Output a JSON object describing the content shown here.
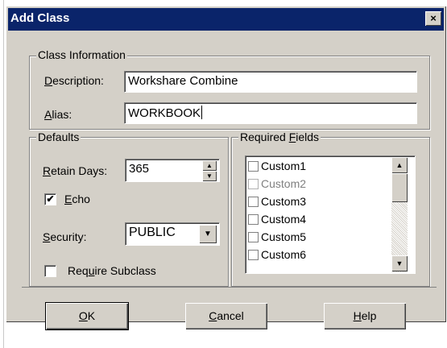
{
  "window": {
    "title": "Add Class",
    "close_glyph": "×"
  },
  "class_info": {
    "legend": "Class Information",
    "description_label": {
      "u": "D",
      "rest": "escription:"
    },
    "description_value": "Workshare Combine",
    "alias_label": {
      "u": "A",
      "rest": "lias:"
    },
    "alias_value": "WORKBOOK"
  },
  "defaults": {
    "legend": "Defaults",
    "retain_label": {
      "u": "R",
      "rest": "etain Days:"
    },
    "retain_value": "365",
    "echo_label": {
      "u": "E",
      "rest": "cho"
    },
    "echo_checked": true,
    "security_label": {
      "u": "S",
      "rest": "ecurity:"
    },
    "security_value": "PUBLIC",
    "require_label": {
      "pre": "Req",
      "u": "u",
      "rest": "ire Subclass"
    },
    "require_checked": false
  },
  "required_fields": {
    "legend": {
      "pre": "Required ",
      "u": "F",
      "rest": "ields"
    },
    "items": [
      {
        "label": "Custom1",
        "disabled": false
      },
      {
        "label": "Custom2",
        "disabled": true
      },
      {
        "label": "Custom3",
        "disabled": false
      },
      {
        "label": "Custom4",
        "disabled": false
      },
      {
        "label": "Custom5",
        "disabled": false
      },
      {
        "label": "Custom6",
        "disabled": false
      }
    ]
  },
  "buttons": {
    "ok": {
      "u": "O",
      "rest": "K"
    },
    "cancel": {
      "u": "C",
      "rest": "ancel"
    },
    "help": {
      "u": "H",
      "rest": "elp"
    }
  },
  "icons": {
    "check": "✔",
    "arrow_up": "▲",
    "arrow_down": "▼"
  }
}
